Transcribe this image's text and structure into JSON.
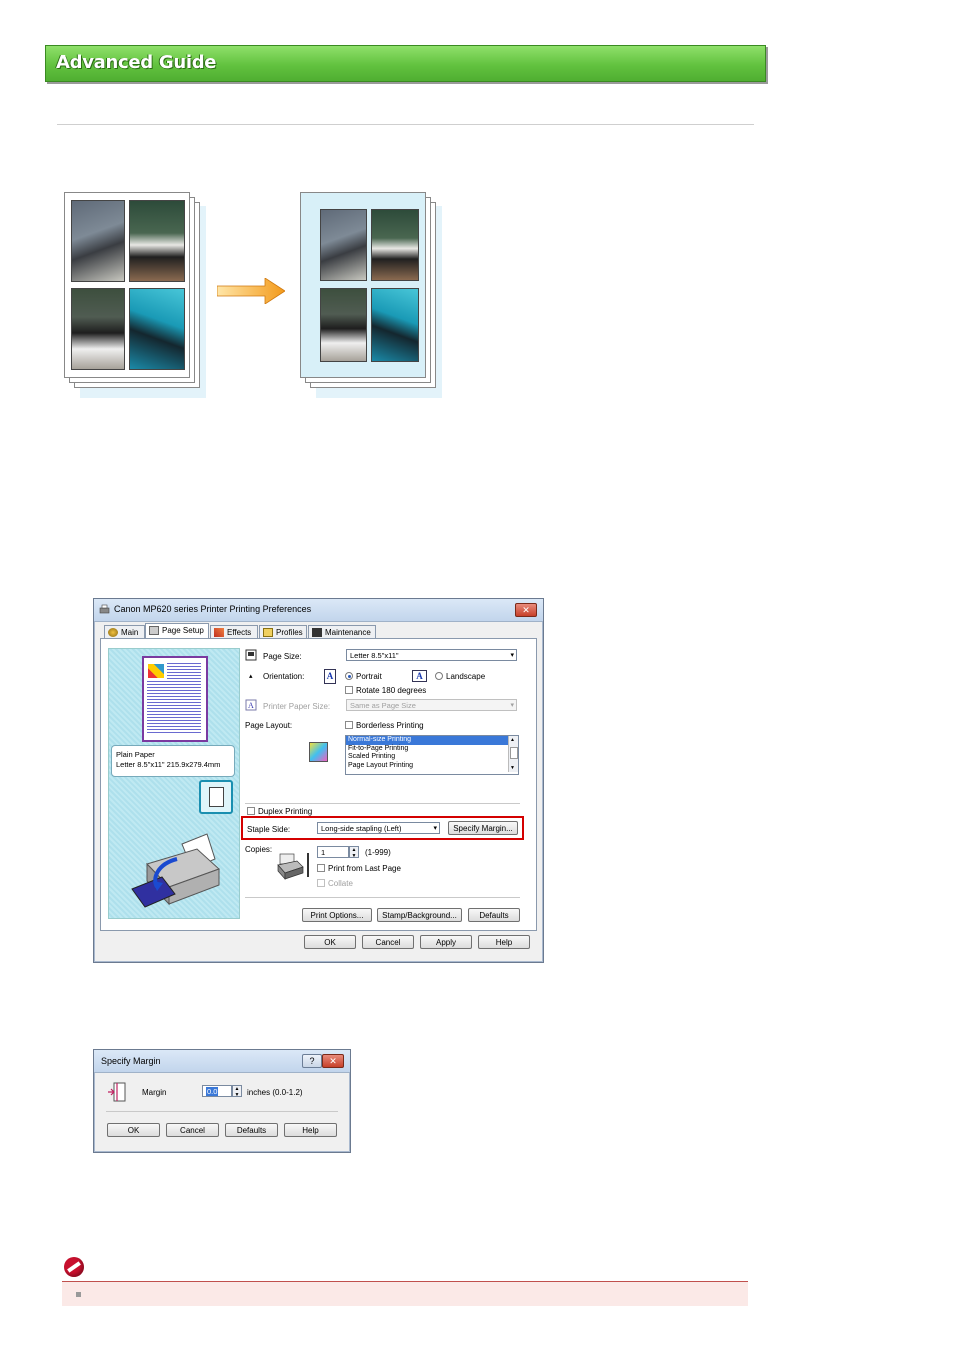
{
  "header": {
    "title": "Advanced Guide"
  },
  "main_dialog": {
    "title": "Canon MP620 series Printer Printing Preferences",
    "close_glyph": "✕",
    "tabs": [
      "Main",
      "Page Setup",
      "Effects",
      "Profiles",
      "Maintenance"
    ],
    "preview_info": [
      "Plain Paper",
      "Letter 8.5\"x11\" 215.9x279.4mm"
    ],
    "page_size_label": "Page Size:",
    "page_size_value": "Letter 8.5\"x11\"",
    "orientation_label": "Orientation:",
    "portrait_label": "Portrait",
    "landscape_label": "Landscape",
    "orientation_glyph": "A",
    "rotate_label": "Rotate 180 degrees",
    "printer_paper_size_label": "Printer Paper Size:",
    "printer_paper_size_value": "Same as Page Size",
    "page_layout_label": "Page Layout:",
    "borderless_label": "Borderless Printing",
    "layout_options": [
      "Normal-size Printing",
      "Fit-to-Page Printing",
      "Scaled Printing",
      "Page Layout Printing"
    ],
    "duplex_label": "Duplex Printing",
    "staple_side_label": "Staple Side:",
    "staple_side_value": "Long-side stapling (Left)",
    "specify_margin_button": "Specify Margin...",
    "copies_label": "Copies:",
    "copies_value": "1",
    "copies_range": "(1-999)",
    "print_from_last_label": "Print from Last Page",
    "collate_label": "Collate",
    "print_options_button": "Print Options...",
    "stamp_button": "Stamp/Background...",
    "defaults_button": "Defaults",
    "ok_button": "OK",
    "cancel_button": "Cancel",
    "apply_button": "Apply",
    "help_button": "Help",
    "dropdown_glyph": "▾",
    "spin_up_glyph": "▲",
    "spin_down_glyph": "▼"
  },
  "margin_dialog": {
    "title": "Specify Margin",
    "help_glyph": "?",
    "close_glyph": "✕",
    "margin_label": "Margin",
    "margin_value": "0.0",
    "units": "inches (0.0-1.2)",
    "ok_button": "OK",
    "cancel_button": "Cancel",
    "defaults_button": "Defaults",
    "help_button": "Help"
  },
  "colors": {
    "banner": "#62c23f",
    "highlight_box": "#d40000",
    "note_bar": "#fbe9e7",
    "preview_bg": "#bfe9f2"
  }
}
